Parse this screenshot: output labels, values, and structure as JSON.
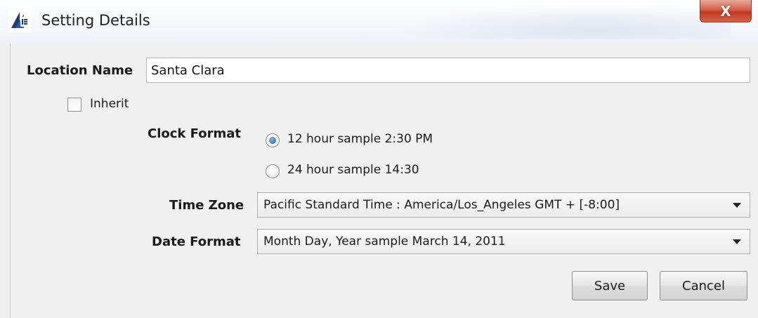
{
  "window": {
    "title": "Setting Details",
    "close_label": "X"
  },
  "form": {
    "location_name_label": "Location Name",
    "location_name_value": "Santa Clara",
    "inherit_label": "Inherit",
    "inherit_checked": false,
    "clock_format_label": "Clock Format",
    "clock_options": [
      {
        "label": "12 hour  sample 2:30 PM",
        "selected": true
      },
      {
        "label": "24 hour  sample 14:30",
        "selected": false
      }
    ],
    "time_zone_label": "Time Zone",
    "time_zone_value": "Pacific Standard Time : America/Los_Angeles GMT + [-8:00]",
    "date_format_label": "Date Format",
    "date_format_value": "Month Day, Year sample March 14, 2011"
  },
  "buttons": {
    "save_label": "Save",
    "cancel_label": "Cancel"
  }
}
